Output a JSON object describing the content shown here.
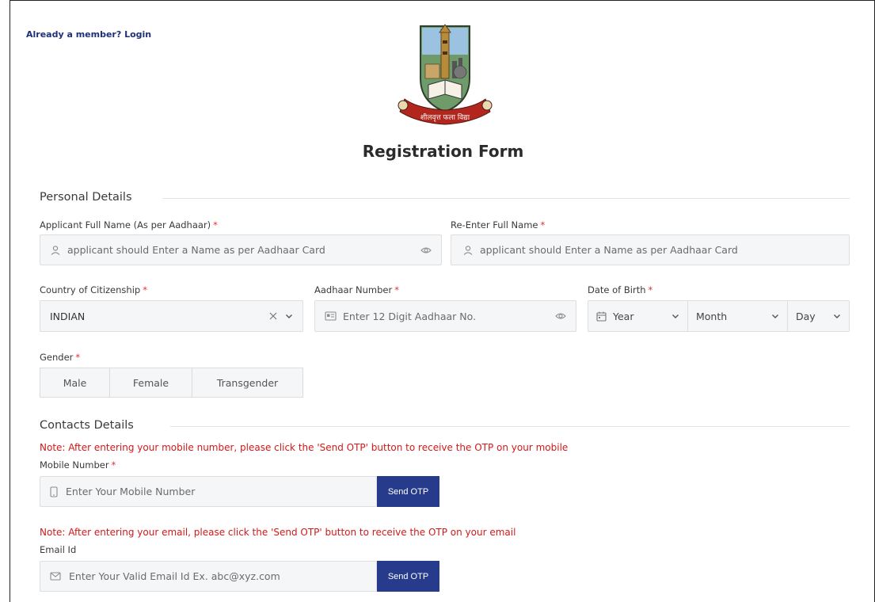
{
  "header": {
    "login_link": "Already a member? Login",
    "form_title": "Registration Form",
    "logo_motto": "शीलवृत्त फला विद्या"
  },
  "personal": {
    "section_title": "Personal Details",
    "full_name": {
      "label": "Applicant Full Name (As per Aadhaar)",
      "required": "*",
      "placeholder": "applicant should Enter a Name as per Aadhaar Card"
    },
    "re_full_name": {
      "label": "Re-Enter Full Name",
      "required": "*",
      "placeholder": "applicant should Enter a Name as per Aadhaar Card"
    },
    "citizenship": {
      "label": "Country of Citizenship",
      "required": "*",
      "value": "INDIAN"
    },
    "aadhaar": {
      "label": "Aadhaar Number",
      "required": "*",
      "placeholder": "Enter 12 Digit Aadhaar No."
    },
    "dob": {
      "label": "Date of Birth",
      "required": "*",
      "year": "Year",
      "month": "Month",
      "day": "Day"
    },
    "gender": {
      "label": "Gender",
      "required": "*",
      "options": [
        "Male",
        "Female",
        "Transgender"
      ]
    }
  },
  "contacts": {
    "section_title": "Contacts Details",
    "mobile_note": "Note: After entering your mobile number, please click the 'Send OTP' button to receive the OTP on your mobile",
    "mobile": {
      "label": "Mobile Number",
      "required": "*",
      "placeholder": "Enter Your Mobile Number",
      "button": "Send OTP"
    },
    "email_note": "Note: After entering your email, please click the 'Send OTP' button to receive the OTP on your email",
    "email": {
      "label": "Email Id",
      "placeholder": "Enter Your Valid Email Id Ex. abc@xyz.com",
      "button": "Send OTP"
    }
  },
  "colors": {
    "primary_button": "#263b8c",
    "note_red": "#d21919",
    "required_star": "#e03131",
    "link_blue": "#1f2f7a"
  }
}
